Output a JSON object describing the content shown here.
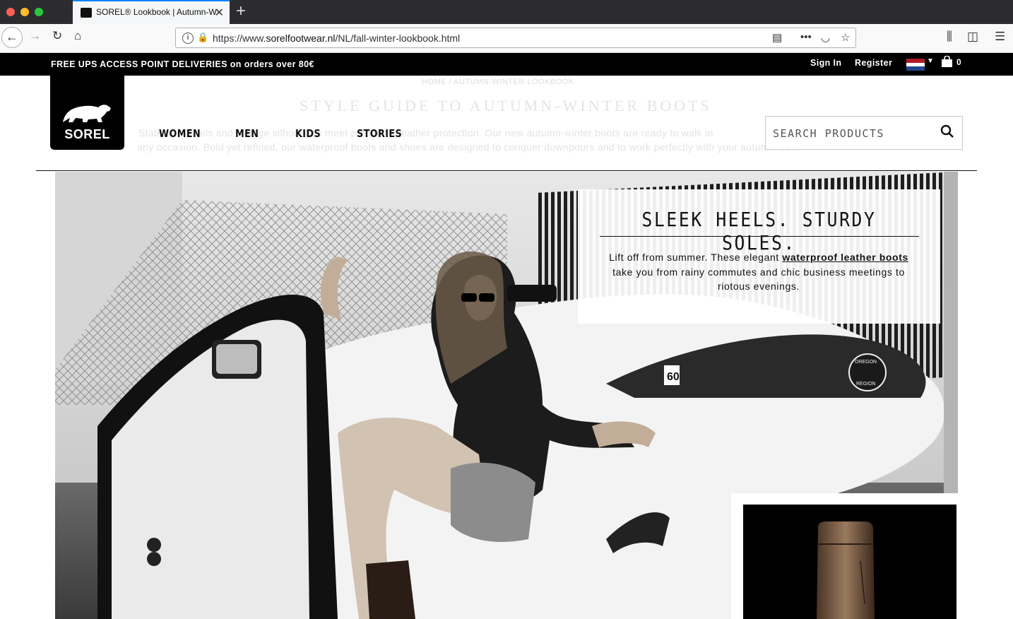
{
  "browser": {
    "tab_title": "SOREL® Lookbook | Autumn-Wi",
    "new_tab": "+",
    "url_prefix": "https://www.",
    "url_domain": "sorelfootwear.nl",
    "url_path": "/NL/fall-winter-lookbook.html",
    "more_label": "•••"
  },
  "promo": {
    "text_bold": "FREE UPS ACCESS POINT DELIVERIES",
    "text_rest": " on orders over 80€",
    "sign_in": "Sign In",
    "register": "Register",
    "cart_count": "0",
    "flag_colors": [
      "#ae1c28",
      "#ffffff",
      "#21468b"
    ]
  },
  "logo": {
    "text": "SOREL"
  },
  "breadcrumb": "HOME  /  AUTUMN-WINTER LOOKBOOK",
  "page_title": "STYLE GUIDE TO AUTUMN-WINTER BOOTS",
  "intro_line1": "Statement heels and vintage silhouettes meet premium weather protection. Our new autumn-winter boots are ready to walk in",
  "intro_line2": "any occasion. Bold yet refined, our waterproof boots and shoes are designed to conquer downpours and to work perfectly with your autumn look.",
  "nav": {
    "women": "WOMEN",
    "men": "MEN",
    "kids": "KIDS",
    "stories": "STORIES"
  },
  "search": {
    "placeholder": "SEARCH PRODUCTS"
  },
  "hero": {
    "heading": "SLEEK HEELS. STURDY SOLES.",
    "body_before": "Lift off from summer. These elegant ",
    "body_link": "waterproof leather boots",
    "body_after": " take you from rainy commutes and chic business meetings to riotous evenings.",
    "car_number": "60",
    "sticker_top": "OREGON",
    "sticker_bottom": "REGION"
  }
}
